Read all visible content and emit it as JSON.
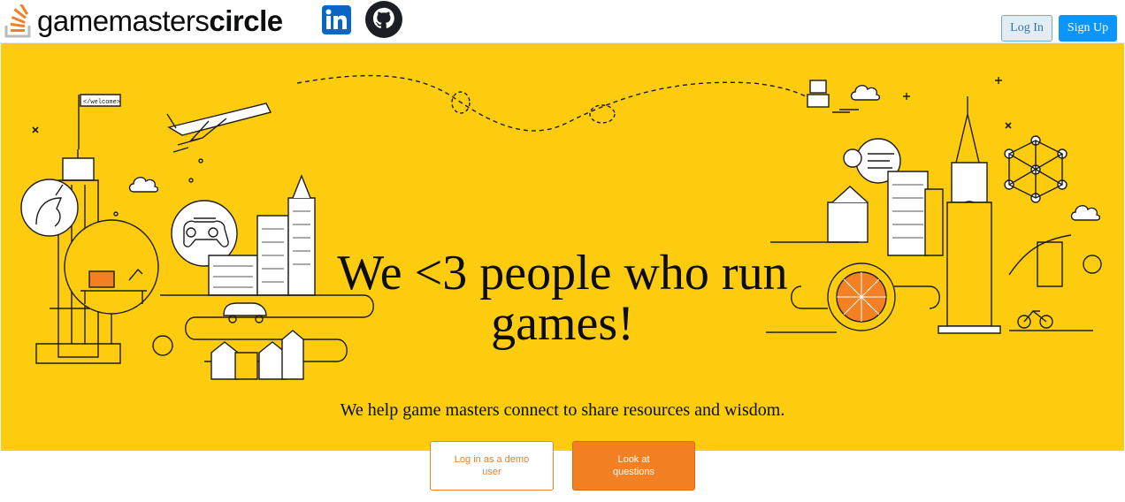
{
  "header": {
    "brand_regular": "gamemasters",
    "brand_bold": "circle",
    "login_label": "Log In",
    "signup_label": "Sign Up",
    "linkedin_icon": "linkedin-icon",
    "github_icon": "github-icon",
    "logo_icon": "stack-logo-icon"
  },
  "hero": {
    "headline": "We <3 people who run games!",
    "subtitle": "We help game masters connect to share resources and wisdom.",
    "welcome_flag": "</welcome>",
    "background_color": "#fecc0f"
  },
  "cta": {
    "demo_label": "Log in as a demo user",
    "questions_label": "Look at questions"
  },
  "colors": {
    "accent_orange": "#f48024",
    "signup_blue": "#0a95ff",
    "login_bg": "#e1ecf4"
  }
}
